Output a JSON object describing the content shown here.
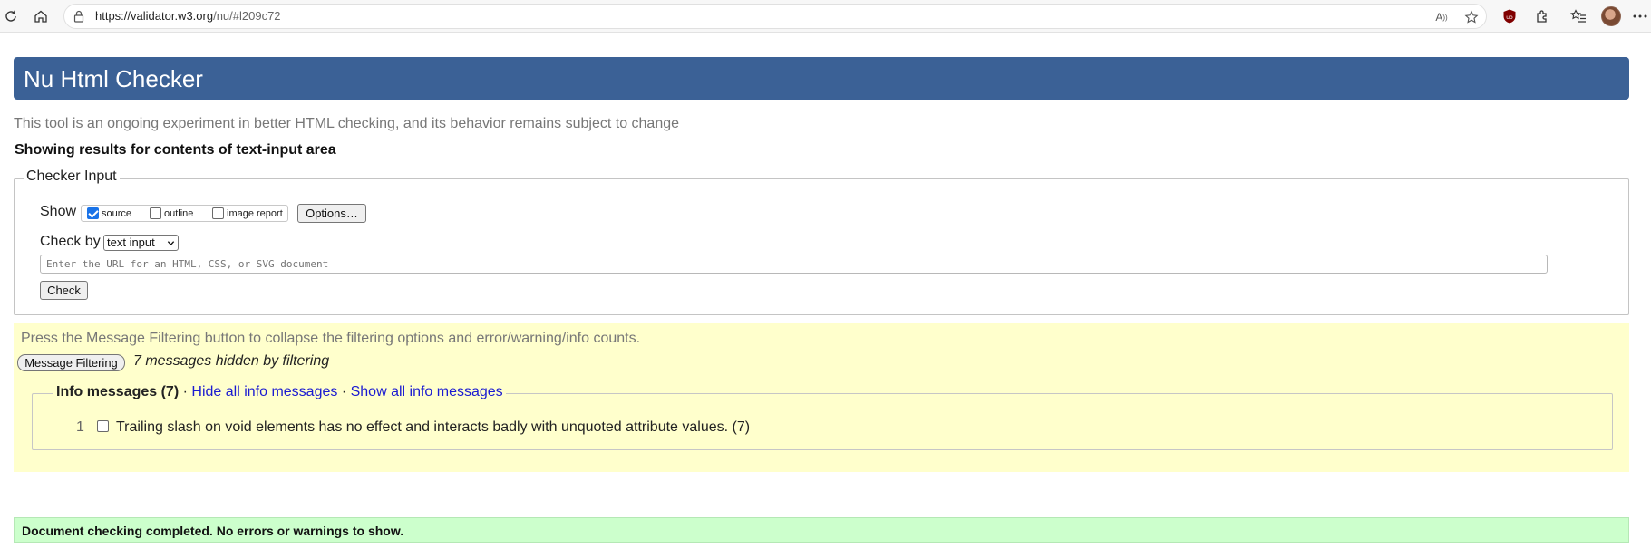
{
  "browser": {
    "url_main": "https://validator.w3.org",
    "url_rest": "/nu/#l209c72"
  },
  "page": {
    "title": "Nu Html Checker",
    "intro": "This tool is an ongoing experiment in better HTML checking, and its behavior remains subject to change",
    "results_heading": "Showing results for contents of text-input area"
  },
  "checker_input": {
    "legend": "Checker Input",
    "show_label": "Show",
    "options": [
      {
        "label": "source",
        "checked": true
      },
      {
        "label": "outline",
        "checked": false
      },
      {
        "label": "image report",
        "checked": false
      }
    ],
    "options_button": "Options…",
    "check_by_label": "Check by",
    "check_by_value": "text input",
    "url_placeholder": "Enter the URL for an HTML, CSS, or SVG document",
    "check_button": "Check"
  },
  "filtering": {
    "hint": "Press the Message Filtering button to collapse the filtering options and error/warning/info counts.",
    "button": "Message Filtering",
    "hidden_count": "7 messages hidden by filtering",
    "info_legend": "Info messages (7)",
    "separator": "·",
    "hide_all": "Hide all info messages",
    "show_all": "Show all info messages",
    "messages": [
      {
        "number": "1",
        "text": "Trailing slash on void elements has no effect and interacts badly with unquoted attribute values. (7)",
        "checked": false
      }
    ]
  },
  "status": {
    "done": "Document checking completed. No errors or warnings to show."
  },
  "colors": {
    "header_bg": "#3b6196",
    "filter_bg": "#ffffcc",
    "success_bg": "#ccffcc",
    "link": "#1b1bd1"
  }
}
